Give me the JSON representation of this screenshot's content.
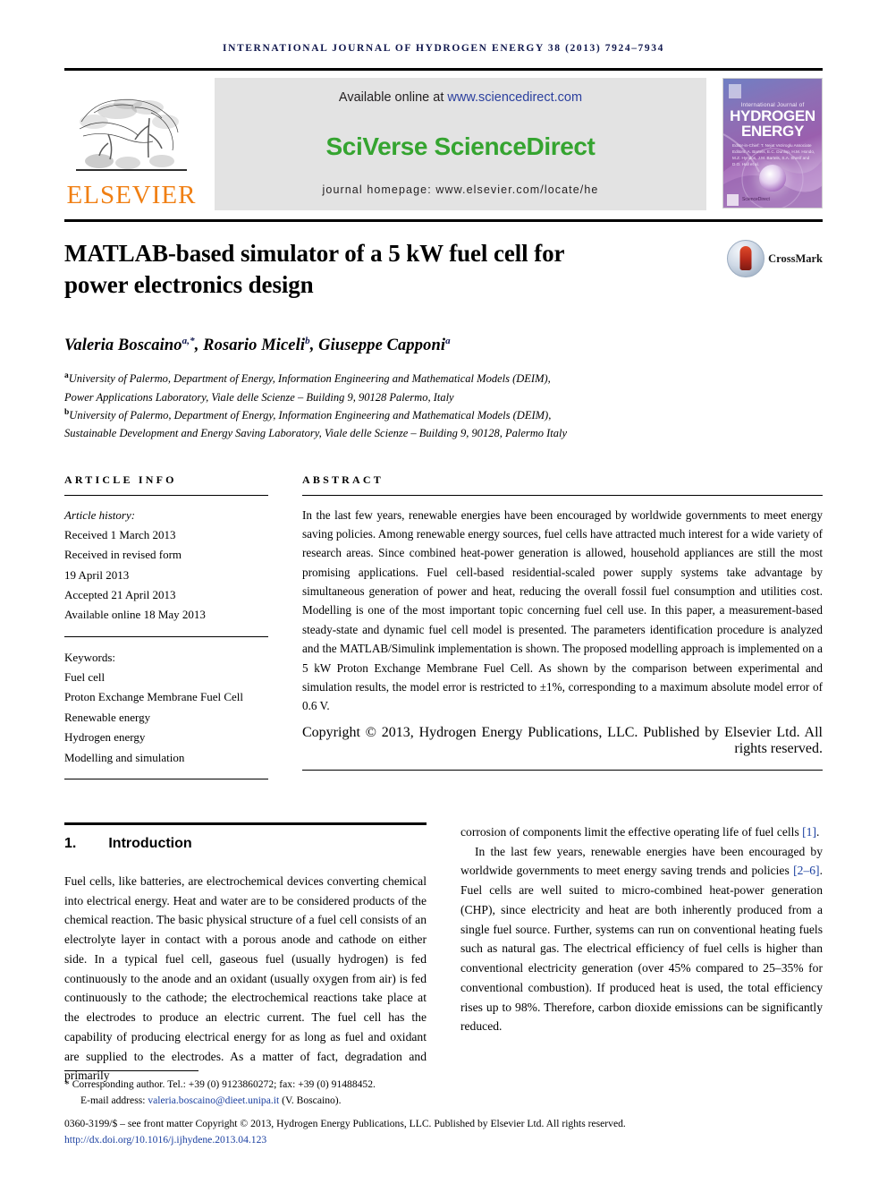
{
  "running_head": "INTERNATIONAL JOURNAL OF HYDROGEN ENERGY 38 (2013) 7924–7934",
  "masthead": {
    "publisher_name": "ELSEVIER",
    "available_prefix": "Available online at ",
    "available_url": "www.sciencedirect.com",
    "platform_logo": "SciVerse ScienceDirect",
    "homepage_line": "journal homepage: www.elsevier.com/locate/he",
    "cover": {
      "kicker": "International Journal of",
      "title_line1": "HYDROGEN",
      "title_line2": "ENERGY",
      "editors": "Editor-in-Chief: T. Nejat Veziroglu\nAssociate Editors: A. Bartels, E.C. Dunlop, H.M. Hondo,\nM.Z. Hyndos, J.M. Bartels,\nS.A. Sherif and D.O. Hall et al.",
      "footer_mark": "ScienceDirect"
    }
  },
  "article": {
    "title": "MATLAB-based simulator of a 5 kW fuel cell for power electronics design",
    "crossmark_label": "CrossMark",
    "authors_plain": "Valeria Boscaino a,*, Rosario Miceli b, Giuseppe Capponi a",
    "authors": [
      {
        "name": "Valeria Boscaino",
        "marks": "a,*"
      },
      {
        "name": "Rosario Miceli",
        "marks": "b"
      },
      {
        "name": "Giuseppe Capponi",
        "marks": "a"
      }
    ],
    "affiliations": [
      {
        "mark": "a",
        "lines": [
          "University of Palermo, Department of Energy, Information Engineering and Mathematical Models (DEIM),",
          "Power Applications Laboratory, Viale delle Scienze – Building 9, 90128 Palermo, Italy"
        ]
      },
      {
        "mark": "b",
        "lines": [
          "University of Palermo, Department of Energy, Information Engineering and Mathematical Models (DEIM),",
          "Sustainable Development and Energy Saving Laboratory, Viale delle Scienze – Building 9, 90128, Palermo Italy"
        ]
      }
    ]
  },
  "article_info": {
    "heading": "ARTICLE INFO",
    "history_label": "Article history:",
    "history": [
      "Received 1 March 2013",
      "Received in revised form",
      "19 April 2013",
      "Accepted 21 April 2013",
      "Available online 18 May 2013"
    ],
    "keywords_label": "Keywords:",
    "keywords": [
      "Fuel cell",
      "Proton Exchange Membrane Fuel Cell",
      "Renewable energy",
      "Hydrogen energy",
      "Modelling and simulation"
    ]
  },
  "abstract": {
    "heading": "ABSTRACT",
    "text": "In the last few years, renewable energies have been encouraged by worldwide governments to meet energy saving policies. Among renewable energy sources, fuel cells have attracted much interest for a wide variety of research areas. Since combined heat-power generation is allowed, household appliances are still the most promising applications. Fuel cell-based residential-scaled power supply systems take advantage by simultaneous generation of power and heat, reducing the overall fossil fuel consumption and utilities cost. Modelling is one of the most important topic concerning fuel cell use. In this paper, a measurement-based steady-state and dynamic fuel cell model is presented. The parameters identification procedure is analyzed and the MATLAB/Simulink implementation is shown. The proposed modelling approach is implemented on a 5 kW Proton Exchange Membrane Fuel Cell. As shown by the comparison between experimental and simulation results, the model error is restricted to ±1%, corresponding to a maximum absolute model error of 0.6 V.",
    "copyright": "Copyright © 2013, Hydrogen Energy Publications, LLC. Published by Elsevier Ltd. All rights reserved."
  },
  "introduction": {
    "number": "1.",
    "title": "Introduction",
    "left_paragraph": "Fuel cells, like batteries, are electrochemical devices converting chemical into electrical energy. Heat and water are to be considered products of the chemical reaction. The basic physical structure of a fuel cell consists of an electrolyte layer in contact with a porous anode and cathode on either side. In a typical fuel cell, gaseous fuel (usually hydrogen) is fed continuously to the anode and an oxidant (usually oxygen from air) is fed continuously to the cathode; the electrochemical reactions take place at the electrodes to produce an electric current. The fuel cell has the capability of producing electrical energy for as long as fuel and oxidant are supplied to the electrodes. As a matter of fact, degradation and primarily",
    "right_paragraph_1_pre": "corrosion of components limit the effective operating life of fuel cells ",
    "right_paragraph_1_ref": "[1]",
    "right_paragraph_1_post": ".",
    "right_paragraph_2_pre": "In the last few years, renewable energies have been encouraged by worldwide governments to meet energy saving trends and policies ",
    "right_paragraph_2_ref": "[2–6]",
    "right_paragraph_2_post": ". Fuel cells are well suited to micro-combined heat-power generation (CHP), since electricity and heat are both inherently produced from a single fuel source. Further, systems can run on conventional heating fuels such as natural gas. The electrical efficiency of fuel cells is higher than conventional electricity generation (over 45% compared to 25–35% for conventional combustion). If produced heat is used, the total efficiency rises up to 98%. Therefore, carbon dioxide emissions can be significantly reduced."
  },
  "footnote": {
    "corresponding_marker": "*",
    "corresponding": "Corresponding author. Tel.: +39 (0) 9123860272; fax: +39 (0) 91488452.",
    "email_label": "E-mail address: ",
    "email": "valeria.boscaino@dieet.unipa.it",
    "email_suffix": " (V. Boscaino).",
    "imprint": "0360-3199/$ – see front matter Copyright © 2013, Hydrogen Energy Publications, LLC. Published by Elsevier Ltd. All rights reserved.",
    "doi": "http://dx.doi.org/10.1016/j.ijhydene.2013.04.123"
  },
  "colors": {
    "running_head": "#11184e",
    "elsevier_orange": "#f07f13",
    "sciencedirect_green": "#35a430",
    "link_blue": "#1a3fa0"
  }
}
